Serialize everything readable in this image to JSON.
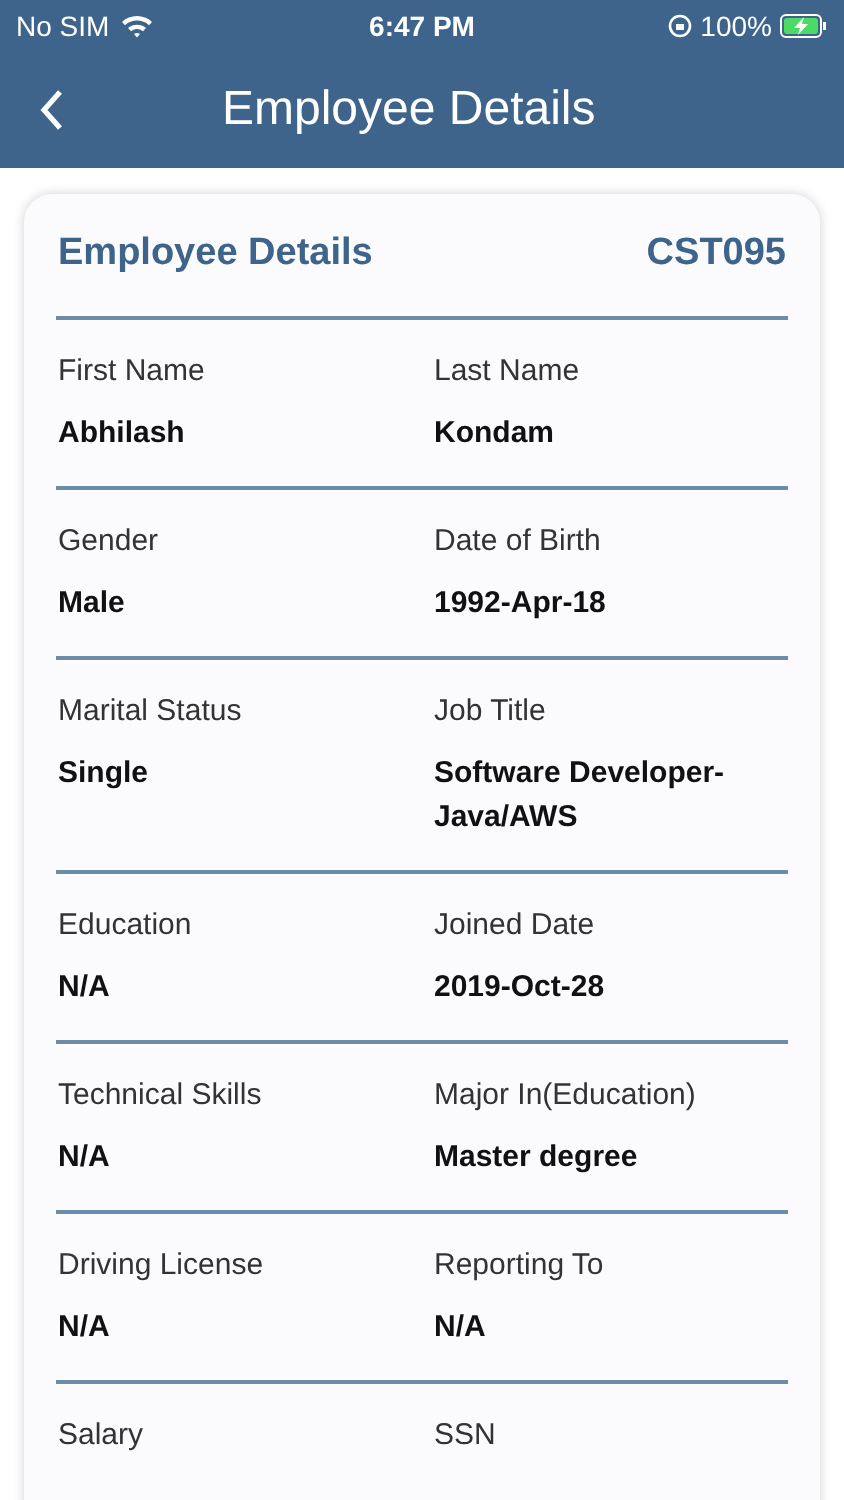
{
  "status_bar": {
    "carrier": "No SIM",
    "time": "6:47 PM",
    "battery": "100%"
  },
  "header": {
    "title": "Employee Details"
  },
  "card": {
    "title": "Employee Details",
    "code": "CST095",
    "rows": [
      [
        {
          "label": "First Name",
          "value": "Abhilash"
        },
        {
          "label": "Last Name",
          "value": "Kondam"
        }
      ],
      [
        {
          "label": "Gender",
          "value": "Male"
        },
        {
          "label": "Date of Birth",
          "value": "1992-Apr-18"
        }
      ],
      [
        {
          "label": "Marital Status",
          "value": "Single"
        },
        {
          "label": "Job Title",
          "value": "Software Developer-Java/AWS"
        }
      ],
      [
        {
          "label": "Education",
          "value": "N/A"
        },
        {
          "label": "Joined Date",
          "value": "2019-Oct-28"
        }
      ],
      [
        {
          "label": "Technical Skills",
          "value": "N/A"
        },
        {
          "label": "Major In(Education)",
          "value": "Master degree"
        }
      ],
      [
        {
          "label": "Driving License",
          "value": "N/A"
        },
        {
          "label": "Reporting To",
          "value": "N/A"
        }
      ],
      [
        {
          "label": "Salary"
        },
        {
          "label": "SSN"
        }
      ]
    ]
  }
}
